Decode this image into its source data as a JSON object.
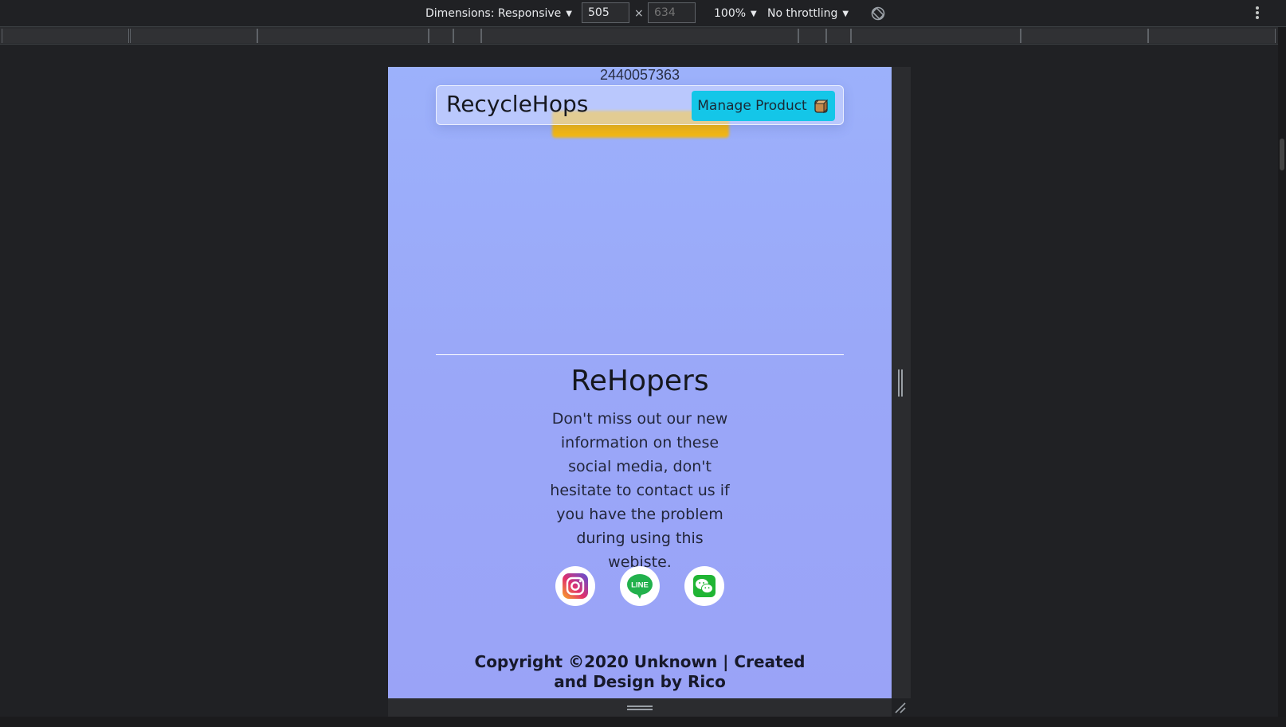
{
  "devtools": {
    "dimensions_label": "Dimensions: Responsive",
    "width_value": "505",
    "height_placeholder": "634",
    "times": "×",
    "zoom_label": "100%",
    "throttling_label": "No throttling",
    "caret": "▼"
  },
  "page": {
    "phone": "2440057363",
    "navbar": {
      "brand": "RecycleHops",
      "manage_button": "Manage Product"
    },
    "footer": {
      "title": "ReHopers",
      "text": "Don't miss out our new information on these social media, don't hesitate to contact us if you have the problem during using this webiste.",
      "socials": [
        {
          "name": "instagram-icon"
        },
        {
          "name": "line-icon",
          "label": "LINE"
        },
        {
          "name": "wechat-icon"
        }
      ],
      "copyright": "Copyright ©2020 Unknown | Created and Design by Rico"
    }
  },
  "colors": {
    "page_bg_top": "#9cb1fb",
    "nav_button": "#14c6e8",
    "yellow_button": "#f4b811"
  }
}
